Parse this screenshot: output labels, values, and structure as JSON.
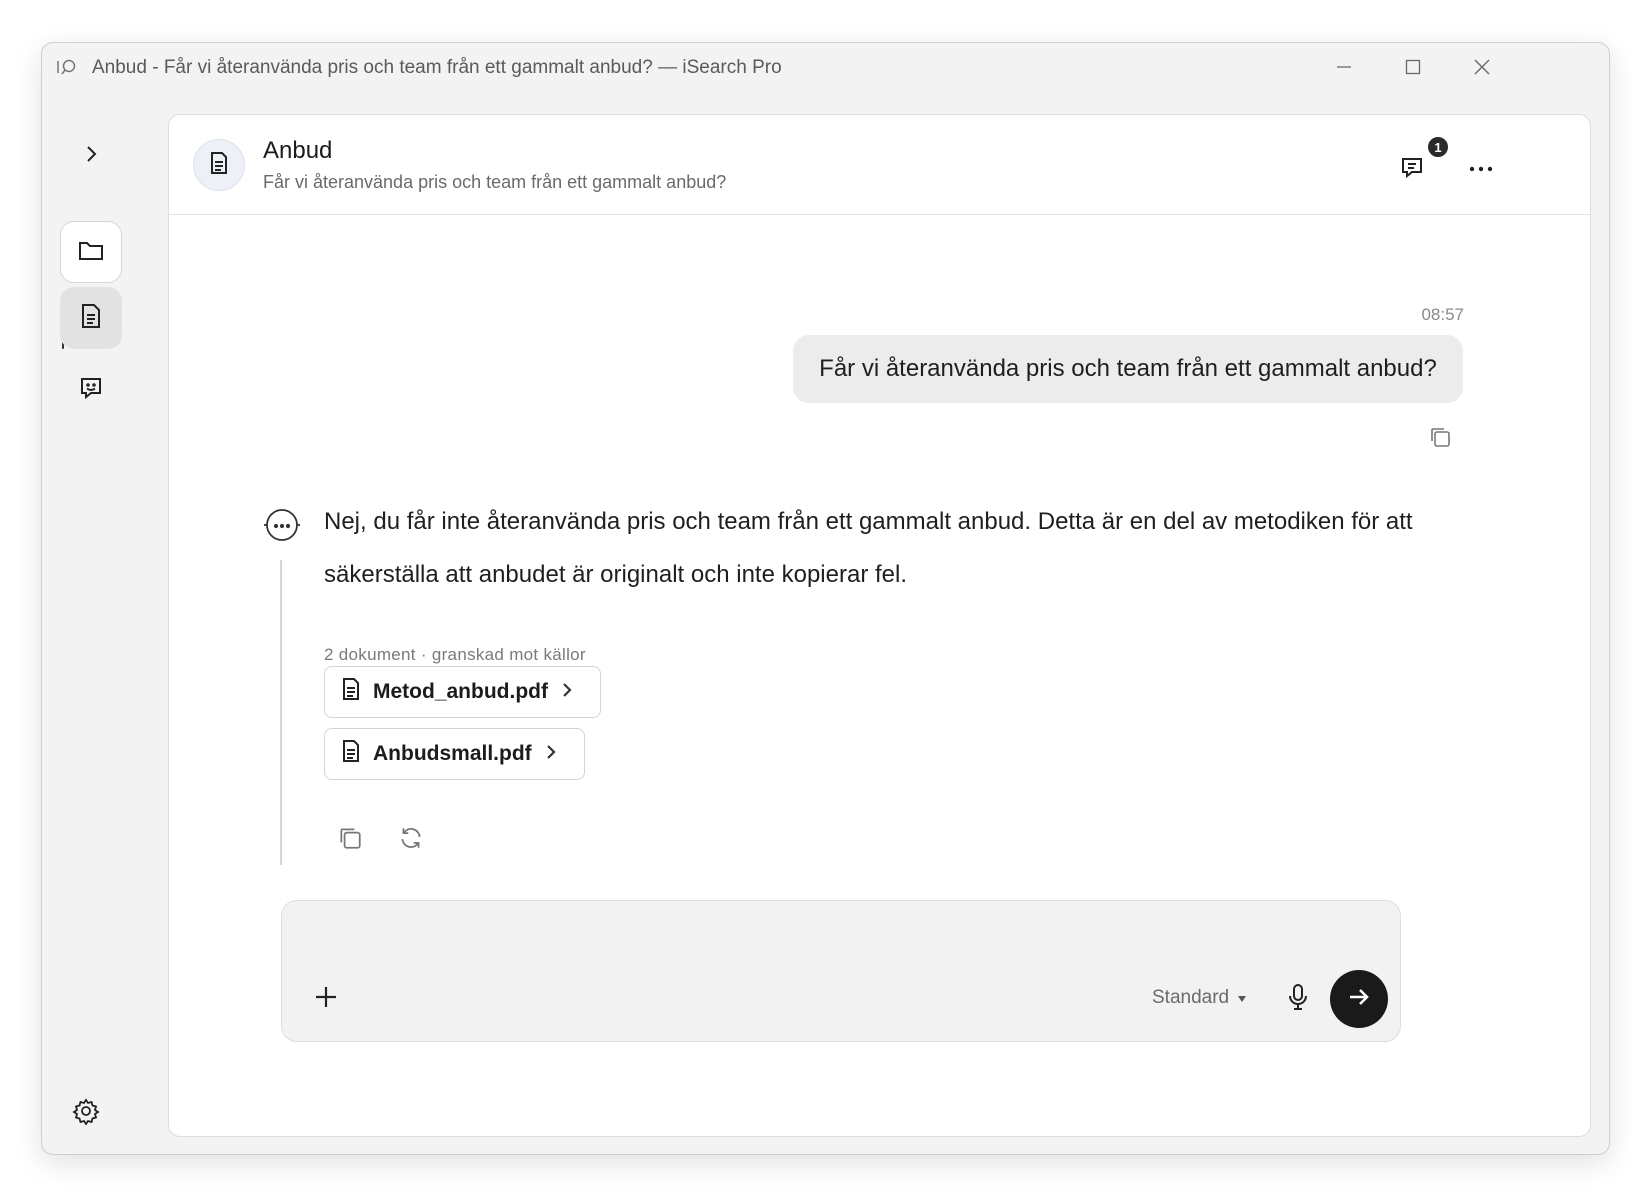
{
  "window": {
    "title": "Anbud - Får vi återanvända pris och team från ett gammalt anbud? — iSearch Pro"
  },
  "sidebar": {
    "items": [
      {
        "name": "expand",
        "icon": "chevron-right-icon"
      },
      {
        "name": "folders",
        "icon": "folder-icon"
      },
      {
        "name": "documents",
        "icon": "document-icon",
        "active": true
      },
      {
        "name": "feedback",
        "icon": "chat-feedback-icon"
      }
    ],
    "settings_icon": "gear-icon"
  },
  "header": {
    "title": "Anbud",
    "subtitle": "Får vi återanvända pris och team från ett gammalt anbud?",
    "notification_count": "1"
  },
  "conversation": {
    "user_message": {
      "time": "08:57",
      "text": "Får vi återanvända pris och team från ett gammalt anbud?"
    },
    "assistant_message": {
      "text": "Nej, du får inte återanvända pris och team från ett gammalt anbud. Detta är en del av metodiken för att säkerställa att anbudet är originalt och inte kopierar fel.",
      "sources_label": "2 dokument · granskad mot källor",
      "sources": [
        {
          "name": "Metod_anbud.pdf"
        },
        {
          "name": "Anbudsmall.pdf"
        }
      ]
    }
  },
  "composer": {
    "placeholder": "",
    "mode": "Standard"
  },
  "colors": {
    "send_button": "#1a1a1a",
    "user_bubble": "#ececec",
    "window_bg": "#f3f3f3"
  }
}
